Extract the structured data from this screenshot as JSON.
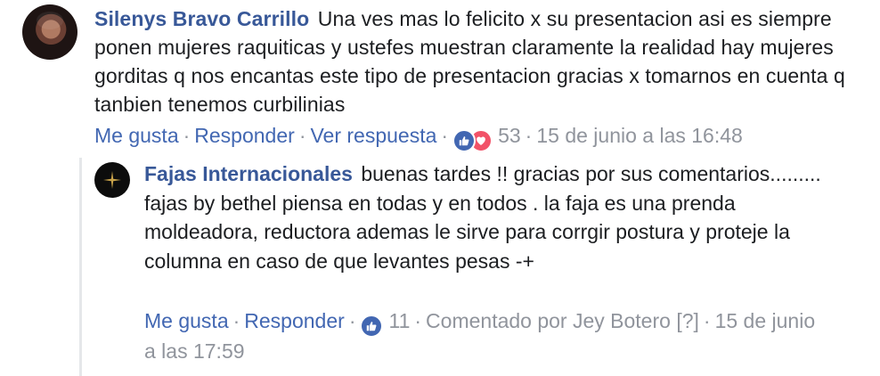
{
  "comment": {
    "author": "Silenys Bravo Carrillo",
    "text": "Una ves mas lo felicito x su presentacion asi es siempre ponen mujeres raquiticas y ustefes muestran claramente la realidad hay mujeres gorditas q nos encantas este tipo de presentacion gracias x tomarnos en cuenta q tanbien tenemos curbilinias",
    "like_label": "Me gusta",
    "reply_label": "Responder",
    "view_reply_label": "Ver respuesta",
    "reaction_count": "53",
    "timestamp": "15 de junio a las 16:48"
  },
  "reply": {
    "author": "Fajas Internacionales",
    "text": "buenas tardes !! gracias por sus comentarios......... fajas by bethel piensa en todas y en todos . la faja es una prenda moldeadora, reductora ademas le sirve para corrgir postura y proteje la columna en caso de que levantes pesas -+",
    "like_label": "Me gusta",
    "reply_label": "Responder",
    "reaction_count": "11",
    "commented_by": "Comentado por Jey Botero",
    "help_mark": "[?]",
    "timestamp": "15 de junio a las 17:59"
  },
  "colors": {
    "author": "#385898",
    "link": "#4267b2",
    "meta": "#90949c",
    "like": "#4267b2",
    "love": "#f25268"
  },
  "icons": [
    "like-icon",
    "love-icon"
  ]
}
